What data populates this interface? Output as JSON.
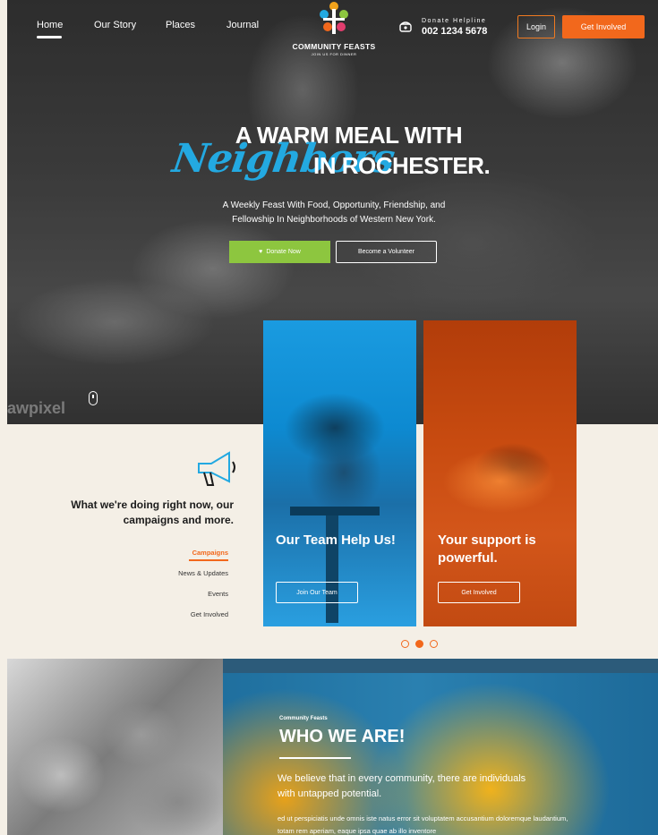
{
  "nav": {
    "home": "Home",
    "story": "Our Story",
    "places": "Places",
    "journal": "Journal"
  },
  "logo": {
    "title": "COMMUNITY FEASTS",
    "subtitle": "JOIN US FOR DINNER"
  },
  "helpline": {
    "label": "Donate Helpline",
    "number": "002 1234 5678"
  },
  "header_buttons": {
    "login": "Login",
    "get_involved": "Get Involved"
  },
  "hero": {
    "line1": "A WARM MEAL WITH",
    "accent": "Neighbors",
    "line2": "IN ROCHESTER.",
    "subtitle": "A Weekly Feast With Food, Opportunity, Friendship, and Fellowship In Neighborhoods of Western New York.",
    "donate_button": "Donate Now",
    "volunteer_button": "Become a Volunteer",
    "watermark": "awpixel"
  },
  "campaign": {
    "title": "What we're doing right now, our campaigns and more.",
    "links": [
      "Campaigns",
      "News & Updates",
      "Events",
      "Get Involved"
    ],
    "active_link": "Campaigns"
  },
  "cards": [
    {
      "title": "Our Team Help Us!",
      "button": "Join Our Team",
      "color": "#1a9be0"
    },
    {
      "title": "Your support is powerful.",
      "button": "Get Involved",
      "color": "#c84b10"
    }
  ],
  "carousel": {
    "count": 3,
    "active_index": 1
  },
  "who": {
    "kicker": "Community Feasts",
    "title": "WHO WE ARE!",
    "lead": "We believe that in every community, there are individuals with untapped potential.",
    "body": "ed ut perspiciatis unde omnis iste natus error sit voluptatem accusantium doloremque laudantium, totam rem aperiam, eaque ipsa quae ab illo inventore"
  },
  "colors": {
    "accent_orange": "#f2681c",
    "accent_blue": "#23a9e1",
    "accent_green": "#8dc63f",
    "section_bg": "#f4efe6"
  },
  "icons": [
    "phone-icon",
    "heart-icon",
    "megaphone-icon",
    "mouse-scroll-icon",
    "logo-icon"
  ]
}
